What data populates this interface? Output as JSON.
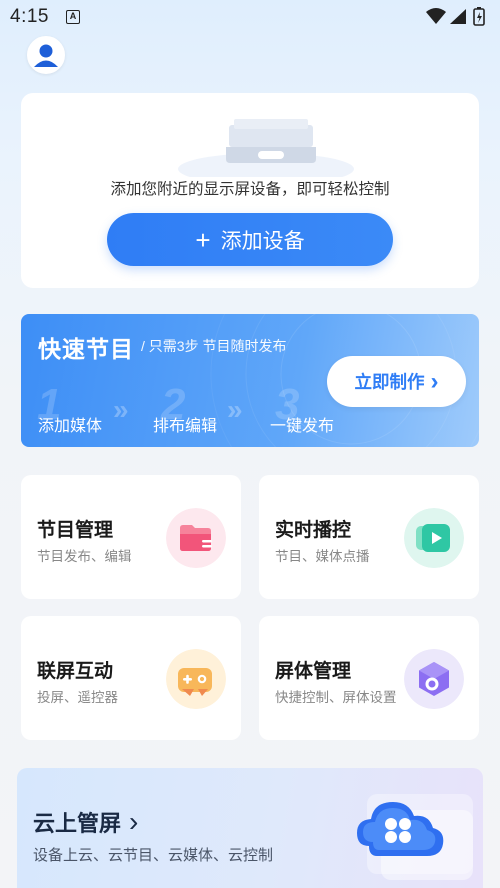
{
  "status_bar": {
    "time": "4:15",
    "notif_letter": "A"
  },
  "device_card": {
    "hint": "添加您附近的显示屏设备，即可轻松控制",
    "add_plus": "+",
    "add_label": "添加设备"
  },
  "quick": {
    "title": "快速节目",
    "subtitle": "/ 只需3步  节目随时发布",
    "steps": [
      {
        "num": "1",
        "label": "添加媒体"
      },
      {
        "num": "2",
        "label": "排布编辑"
      },
      {
        "num": "3",
        "label": "一键发布"
      }
    ],
    "arrow": "»",
    "make_label": "立即制作",
    "make_chevron": "›"
  },
  "features": [
    {
      "title": "节目管理",
      "desc": "节目发布、编辑",
      "icon": "folder-icon"
    },
    {
      "title": "实时播控",
      "desc": "节目、媒体点播",
      "icon": "play-icon"
    },
    {
      "title": "联屏互动",
      "desc": "投屏、遥控器",
      "icon": "gamepad-icon"
    },
    {
      "title": "屏体管理",
      "desc": "快捷控制、屏体设置",
      "icon": "settings-nut-icon"
    }
  ],
  "cloud": {
    "title": "云上管屏",
    "chevron": "›",
    "desc": "设备上云、云节目、云媒体、云控制"
  },
  "colors": {
    "primary": "#2f7df5",
    "card_bg": "#ffffff",
    "page_bg": "#f3f4f7"
  }
}
